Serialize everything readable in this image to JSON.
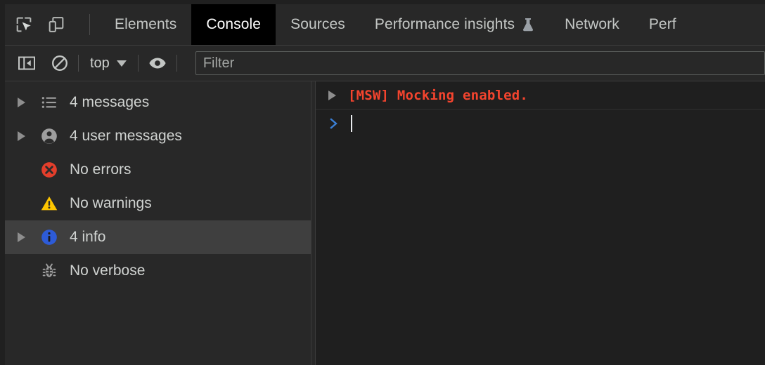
{
  "window": {
    "app": "Chrome DevTools",
    "theme_background": "#202020"
  },
  "tabbar": {
    "left_icons": [
      {
        "name": "inspect-element-icon",
        "label": "Inspect element"
      },
      {
        "name": "device-toolbar-icon",
        "label": "Toggle device toolbar"
      }
    ],
    "tabs": [
      {
        "label": "Elements",
        "active": false,
        "experiment": false
      },
      {
        "label": "Console",
        "active": true,
        "experiment": false
      },
      {
        "label": "Sources",
        "active": false,
        "experiment": false
      },
      {
        "label": "Performance insights",
        "active": false,
        "experiment": true
      },
      {
        "label": "Network",
        "active": false,
        "experiment": false
      },
      {
        "label": "Perf",
        "active": false,
        "experiment": false
      }
    ]
  },
  "console_toolbar": {
    "sidebar_toggle": {
      "icon": "console-sidebar-icon",
      "active": true
    },
    "clear_console": {
      "icon": "clear-console-icon",
      "label": "Clear console"
    },
    "context": {
      "value": "top",
      "caret": "chevron-down-icon"
    },
    "live_expression": {
      "icon": "eye-icon",
      "label": "Create live expression"
    },
    "filter": {
      "value": "",
      "placeholder": "Filter"
    }
  },
  "sidebar": {
    "items": [
      {
        "label": "4 messages",
        "icon": "list-icon",
        "twisty": true,
        "selected": false
      },
      {
        "label": "4 user messages",
        "icon": "person-icon",
        "twisty": true,
        "selected": false
      },
      {
        "label": "No errors",
        "icon": "error-icon",
        "twisty": false,
        "selected": false
      },
      {
        "label": "No warnings",
        "icon": "warning-icon",
        "twisty": false,
        "selected": false
      },
      {
        "label": "4 info",
        "icon": "info-icon",
        "twisty": true,
        "selected": true
      },
      {
        "label": "No verbose",
        "icon": "bug-icon",
        "twisty": false,
        "selected": false
      }
    ]
  },
  "console": {
    "messages": [
      {
        "text": "[MSW] Mocking enabled.",
        "color": "#f4442e",
        "twisty": true,
        "level": "info"
      }
    ],
    "prompt": {
      "chevron": "prompt-chevron-icon",
      "value": "",
      "caret_visible": true
    }
  },
  "colors": {
    "accent_blue": "#3b7fd4",
    "error_red": "#e33e2b",
    "warning_yellow": "#fdc500",
    "info_blue": "#2d5bd7",
    "message_orange": "#f4442e",
    "sidebar_bg": "#282828",
    "console_bg": "#1f1f1f",
    "selected_row": "#3f3f3f",
    "text": "#d0d3d1"
  }
}
